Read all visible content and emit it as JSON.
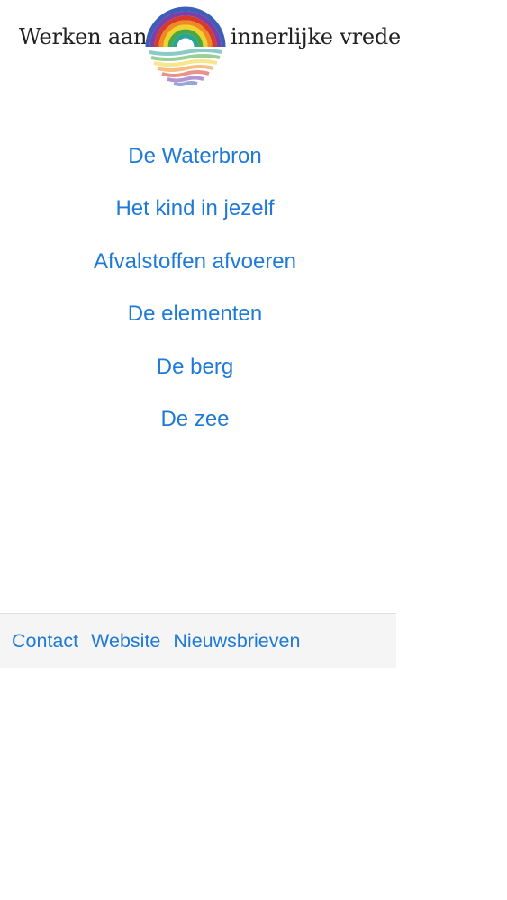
{
  "header": {
    "title_left": "Werken aan",
    "title_right": "innerlijke vrede",
    "logo_icon": "rainbow-reflection-icon"
  },
  "menu": {
    "items": [
      {
        "label": "De Waterbron"
      },
      {
        "label": "Het kind in jezelf"
      },
      {
        "label": "Afvalstoffen afvoeren"
      },
      {
        "label": "De elementen"
      },
      {
        "label": "De berg"
      },
      {
        "label": "De zee"
      }
    ]
  },
  "footer": {
    "links": [
      {
        "label": "Contact"
      },
      {
        "label": "Website"
      },
      {
        "label": "Nieuwsbrieven"
      }
    ]
  },
  "colors": {
    "link": "#1e7ad6",
    "footer_bg": "#f5f5f5",
    "title_text": "#222222"
  }
}
